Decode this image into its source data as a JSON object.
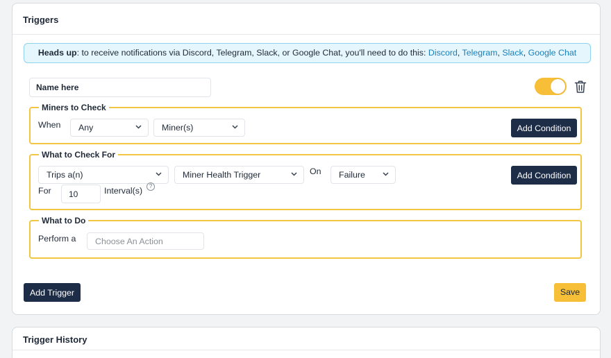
{
  "triggers_card": {
    "title": "Triggers",
    "alert": {
      "prefix": "Heads up",
      "message": ": to receive notifications via Discord, Telegram, Slack, or Google Chat, you'll need to do this: ",
      "links": [
        "Discord",
        "Telegram",
        "Slack",
        "Google Chat"
      ],
      "separator": ", "
    },
    "trigger": {
      "name_placeholder": "Name here",
      "enabled": true,
      "enabled_color": "#f7be38",
      "miners_group": {
        "legend": "Miners to Check",
        "when_label": "When",
        "quantifier_value": "Any",
        "miners_value": "Miner(s)",
        "add_condition_label": "Add Condition"
      },
      "check_group": {
        "legend": "What to Check For",
        "type_value": "Trips a(n)",
        "trigger_value": "Miner Health Trigger",
        "on_label": "On",
        "on_value": "Failure",
        "add_condition_label": "Add Condition",
        "for_label": "For",
        "interval_value": "10",
        "interval_label": "Interval(s)",
        "help_glyph": "?"
      },
      "action_group": {
        "legend": "What to Do",
        "perform_label": "Perform a",
        "action_placeholder": "Choose An Action"
      }
    },
    "add_trigger_label": "Add Trigger",
    "save_label": "Save",
    "accent_color": "#f2c542",
    "dark_button_color": "#1e2d47"
  },
  "history_card": {
    "title": "Trigger History"
  }
}
